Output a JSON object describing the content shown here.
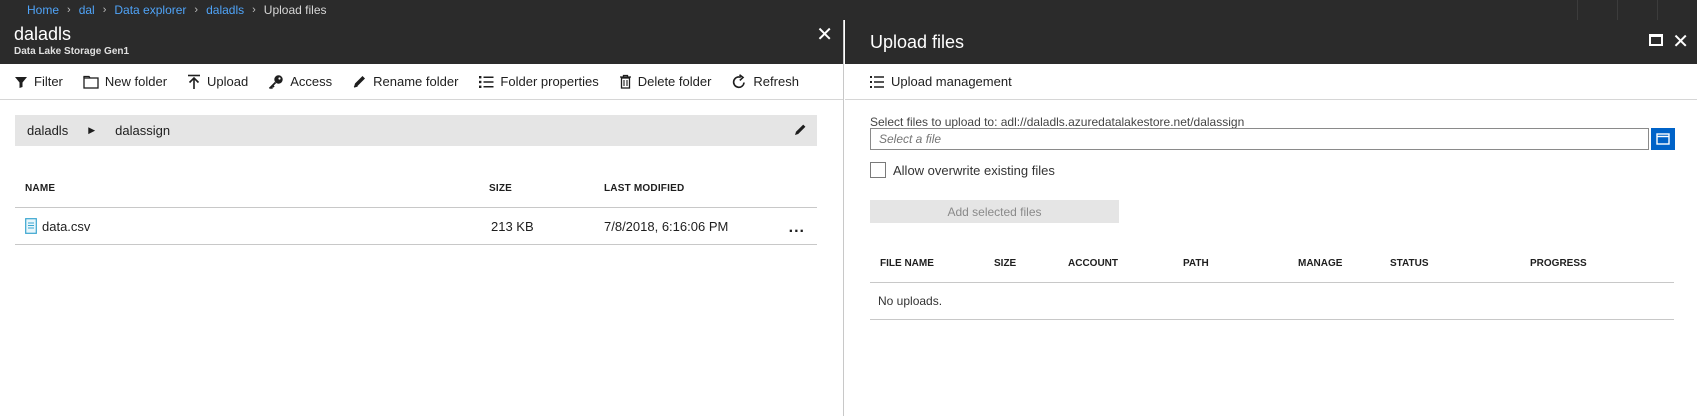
{
  "breadcrumb": {
    "items": [
      "Home",
      "dal",
      "Data explorer",
      "daladls"
    ],
    "current": "Upload files"
  },
  "left_blade": {
    "title": "daladls",
    "subtitle": "Data Lake Storage Gen1",
    "toolbar": {
      "filter": "Filter",
      "new_folder": "New folder",
      "upload": "Upload",
      "access": "Access",
      "rename_folder": "Rename folder",
      "folder_properties": "Folder properties",
      "delete_folder": "Delete folder",
      "refresh": "Refresh"
    },
    "path": [
      "daladls",
      "dalassign"
    ],
    "table": {
      "columns": [
        "NAME",
        "SIZE",
        "LAST MODIFIED"
      ],
      "rows": [
        {
          "name": "data.csv",
          "size": "213 KB",
          "modified": "7/8/2018, 6:16:06 PM",
          "more": "..."
        }
      ]
    }
  },
  "right_blade": {
    "title": "Upload files",
    "toolbar": {
      "upload_management": "Upload management"
    },
    "select_label": "Select files to upload to: adl://daladls.azuredatalakestore.net/dalassign",
    "file_placeholder": "Select a file",
    "overwrite_label": "Allow overwrite existing files",
    "add_button": "Add selected files",
    "table": {
      "columns": [
        "FILE NAME",
        "SIZE",
        "ACCOUNT",
        "PATH",
        "MANAGE",
        "STATUS",
        "PROGRESS"
      ],
      "empty_text": "No uploads."
    }
  },
  "colors": {
    "header_bg": "#2b2b2b",
    "link": "#4fa3f7",
    "accent_button": "#0063c8",
    "path_bg": "#e5e5e5"
  },
  "icons": {
    "filter": "filter-icon",
    "new_folder": "folder-icon",
    "upload": "upload-icon",
    "access": "key-icon",
    "rename": "pencil-icon",
    "properties": "list-icon",
    "delete": "trash-icon",
    "refresh": "refresh-icon",
    "close": "close-icon",
    "maximize": "maximize-icon",
    "browse": "folder-browse-icon",
    "file": "file-icon"
  }
}
